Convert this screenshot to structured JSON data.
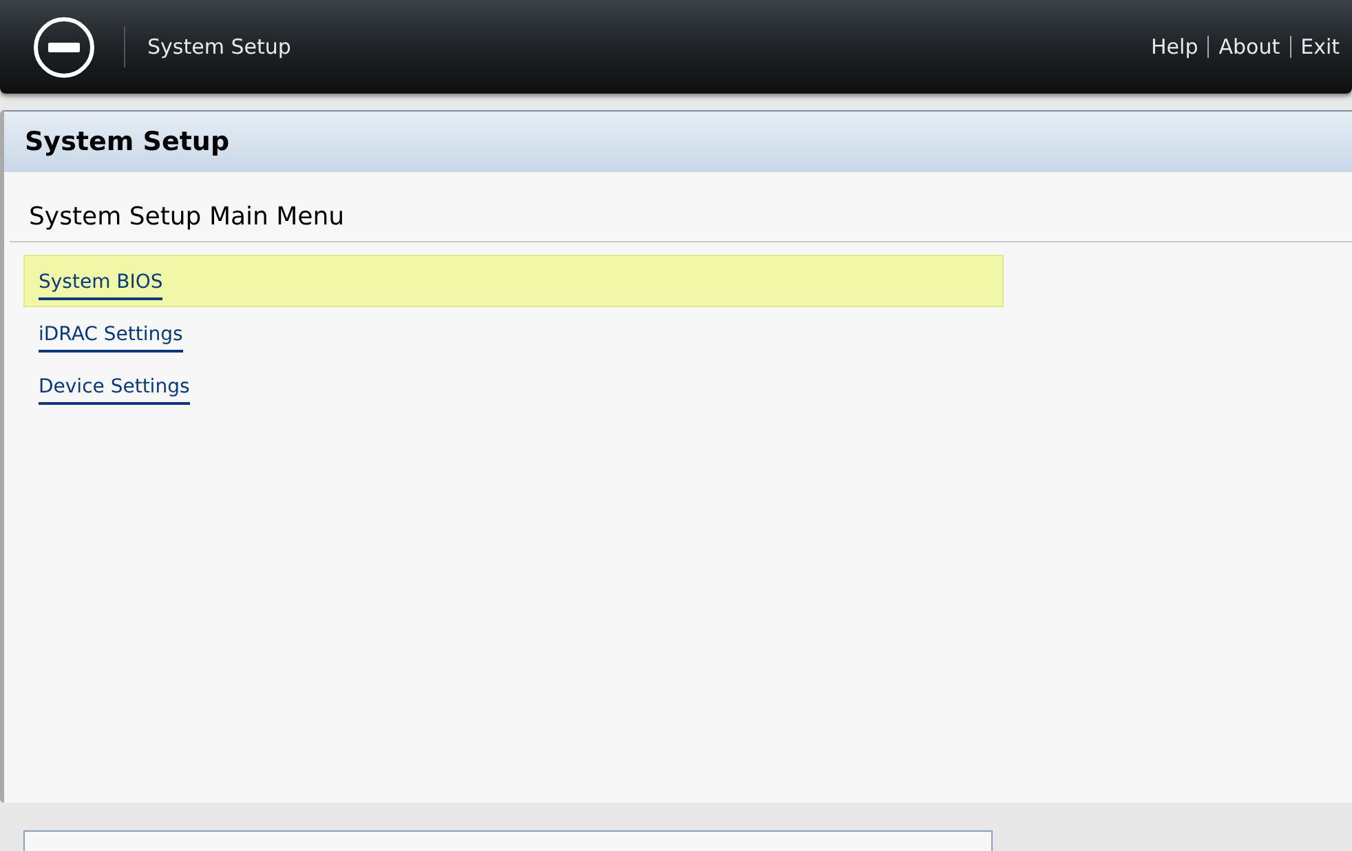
{
  "header": {
    "title": "System Setup",
    "links": [
      "Help",
      "About",
      "Exit"
    ]
  },
  "panel": {
    "title": "System Setup",
    "heading": "System Setup Main Menu",
    "items": [
      {
        "label": "System BIOS",
        "selected": true
      },
      {
        "label": "iDRAC Settings",
        "selected": false
      },
      {
        "label": "Device Settings",
        "selected": false
      }
    ]
  }
}
